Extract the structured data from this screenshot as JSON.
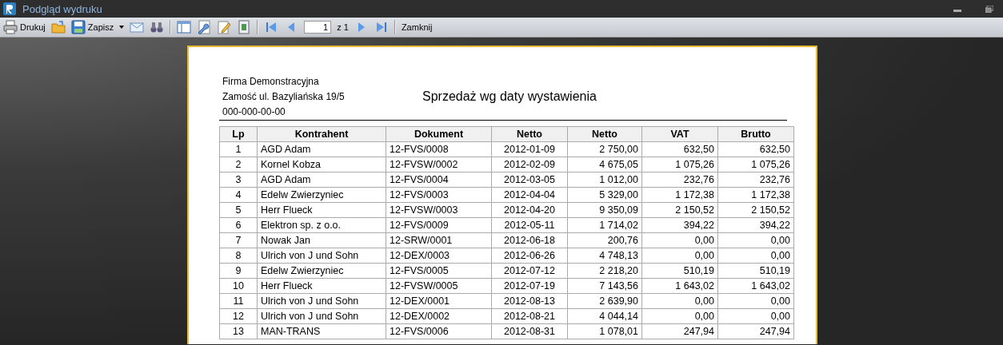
{
  "window": {
    "title": "Podgląd wydruku"
  },
  "toolbar": {
    "print_label": "Drukuj",
    "save_label": "Zapisz",
    "page_input": "1",
    "page_count": "z 1",
    "close_label": "Zamknij"
  },
  "report": {
    "company": [
      "Firma Demonstracyjna",
      "Zamość ul. Bazyliańska 19/5",
      "000-000-00-00"
    ],
    "title": "Sprzedaż wg daty wystawienia",
    "columns": [
      "Lp",
      "Kontrahent",
      "Dokument",
      "Netto",
      "Netto",
      "VAT",
      "Brutto"
    ],
    "rows": [
      [
        "1",
        "AGD Adam",
        "12-FVS/0008",
        "2012-01-09",
        "2 750,00",
        "632,50",
        "632,50"
      ],
      [
        "2",
        "Kornel Kobza",
        "12-FVSW/0002",
        "2012-02-09",
        "4 675,05",
        "1 075,26",
        "1 075,26"
      ],
      [
        "3",
        "AGD Adam",
        "12-FVS/0004",
        "2012-03-05",
        "1 012,00",
        "232,76",
        "232,76"
      ],
      [
        "4",
        "Edelw Zwierzyniec",
        "12-FVS/0003",
        "2012-04-04",
        "5 329,00",
        "1 172,38",
        "1 172,38"
      ],
      [
        "5",
        "Herr Flueck",
        "12-FVSW/0003",
        "2012-04-20",
        "9 350,09",
        "2 150,52",
        "2 150,52"
      ],
      [
        "6",
        "Elektron sp. z o.o.",
        "12-FVS/0009",
        "2012-05-11",
        "1 714,02",
        "394,22",
        "394,22"
      ],
      [
        "7",
        "Nowak Jan",
        "12-SRW/0001",
        "2012-06-18",
        "200,76",
        "0,00",
        "0,00"
      ],
      [
        "8",
        "Ulrich von J und Sohn",
        "12-DEX/0003",
        "2012-06-26",
        "4 748,13",
        "0,00",
        "0,00"
      ],
      [
        "9",
        "Edelw Zwierzyniec",
        "12-FVS/0005",
        "2012-07-12",
        "2 218,20",
        "510,19",
        "510,19"
      ],
      [
        "10",
        "Herr Flueck",
        "12-FVSW/0005",
        "2012-07-19",
        "7 143,56",
        "1 643,02",
        "1 643,02"
      ],
      [
        "11",
        "Ulrich von J und Sohn",
        "12-DEX/0001",
        "2012-08-13",
        "2 639,90",
        "0,00",
        "0,00"
      ],
      [
        "12",
        "Ulrich von J und Sohn",
        "12-DEX/0002",
        "2012-08-21",
        "4 044,14",
        "0,00",
        "0,00"
      ],
      [
        "13",
        "MAN-TRANS",
        "12-FVS/0006",
        "2012-08-31",
        "1 078,01",
        "247,94",
        "247,94"
      ]
    ]
  }
}
